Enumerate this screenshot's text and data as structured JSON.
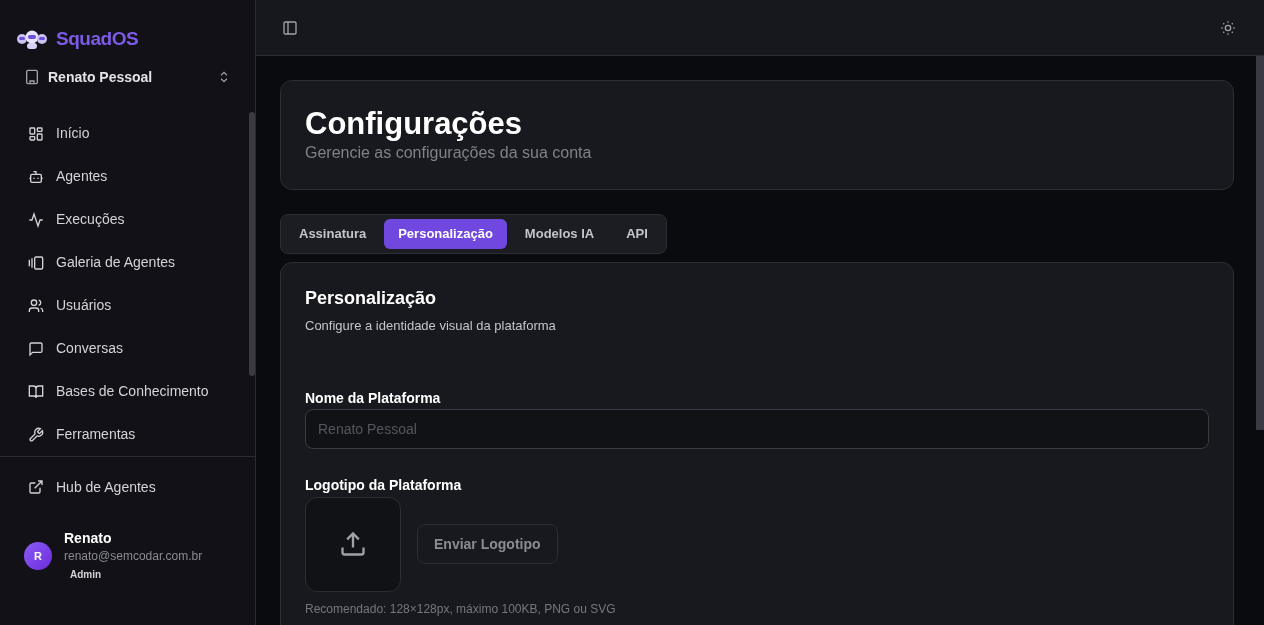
{
  "brand": {
    "name": "SquadOS"
  },
  "workspace": {
    "name": "Renato Pessoal"
  },
  "sidebar": {
    "items": [
      {
        "label": "Início",
        "selected": false
      },
      {
        "label": "Agentes",
        "selected": false
      },
      {
        "label": "Execuções",
        "selected": false
      },
      {
        "label": "Galeria de Agentes",
        "selected": false
      },
      {
        "label": "Usuários",
        "selected": false
      },
      {
        "label": "Conversas",
        "selected": false
      },
      {
        "label": "Bases de Conhecimento",
        "selected": false
      },
      {
        "label": "Ferramentas",
        "selected": false
      }
    ],
    "footer_link": {
      "label": "Hub de Agentes"
    }
  },
  "user": {
    "initial": "R",
    "name": "Renato",
    "email": "renato@semcodar.com.br",
    "role": "Admin"
  },
  "page": {
    "title": "Configurações",
    "subtitle": "Gerencie as configurações da sua conta"
  },
  "tabs": [
    {
      "label": "Assinatura",
      "selected": false
    },
    {
      "label": "Personalização",
      "selected": true
    },
    {
      "label": "Modelos IA",
      "selected": false
    },
    {
      "label": "API",
      "selected": false
    }
  ],
  "panel": {
    "title": "Personalização",
    "description": "Configure a identidade visual da plataforma",
    "name_field": {
      "label": "Nome da Plataforma",
      "placeholder": "Renato Pessoal"
    },
    "logo": {
      "label": "Logotipo da Plataforma",
      "button": "Enviar Logotipo",
      "hint": "Recomendado: 128×128px, máximo 100KB, PNG ou SVG"
    }
  }
}
